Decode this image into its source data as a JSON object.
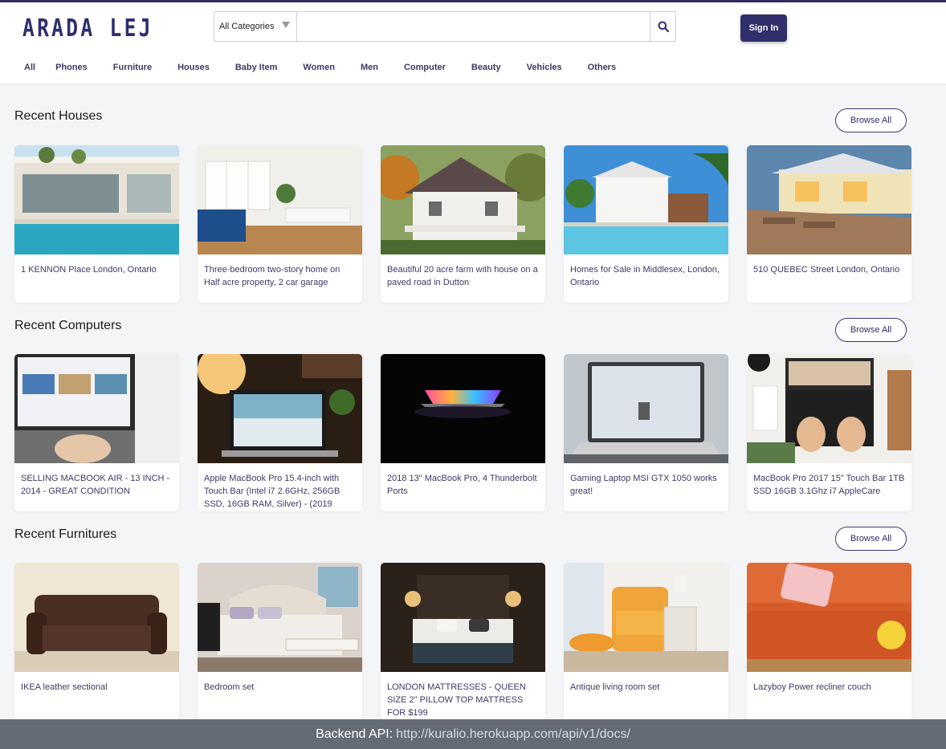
{
  "brand": {
    "logo": "ARADA LEJ"
  },
  "search": {
    "category": "All Categories",
    "placeholder": ""
  },
  "header": {
    "signin_label": "Sign In"
  },
  "nav": [
    "All",
    "Phones",
    "Furniture",
    "Houses",
    "Baby Item",
    "Women",
    "Men",
    "Computer",
    "Beauty",
    "Vehicles",
    "Others"
  ],
  "sections": [
    {
      "title": "Recent Houses",
      "browse_label": "Browse All",
      "items": [
        {
          "title": "1 KENNON Place London, Ontario"
        },
        {
          "title": "Three-bedroom two-story home on Half acre property, 2 car garage"
        },
        {
          "title": "Beautiful 20 acre farm with house on a paved road in Dutton"
        },
        {
          "title": "Homes for Sale in Middlesex, London, Ontario"
        },
        {
          "title": "510 QUEBEC Street London, Ontario"
        }
      ]
    },
    {
      "title": "Recent Computers",
      "browse_label": "Browse All",
      "items": [
        {
          "title": "SELLING MACBOOK AIR - 13 INCH - 2014 - GREAT CONDITION"
        },
        {
          "title": "Apple MacBook Pro 15.4-inch with Touch Bar (Intel i7 2.6GHz, 256GB SSD, 16GB RAM, Silver) - (2019"
        },
        {
          "title": "2018 13\" MacBook Pro, 4 Thunderbolt Ports"
        },
        {
          "title": "Gaming Laptop MSI GTX 1050 works great!"
        },
        {
          "title": "MacBook Pro 2017 15\" Touch Bar 1TB SSD 16GB 3.1Ghz i7 AppleCare"
        }
      ]
    },
    {
      "title": "Recent Furnitures",
      "browse_label": "Browse All",
      "items": [
        {
          "title": "IKEA leather sectional"
        },
        {
          "title": "Bedroom set"
        },
        {
          "title": "LONDON MATTRESSES - QUEEN SIZE 2\" PILLOW TOP MATTRESS FOR $199"
        },
        {
          "title": "Antique living room set"
        },
        {
          "title": "Lazyboy Power recliner couch"
        }
      ]
    }
  ],
  "footer": {
    "label": "Backend API:",
    "link": "http://kuralio.herokuapp.com/api/v1/docs/"
  },
  "colors": {
    "brand": "#2f2e6e",
    "signin_bg": "#302e6b",
    "footer_bg": "#636b75",
    "background": "#f4f5f6"
  }
}
